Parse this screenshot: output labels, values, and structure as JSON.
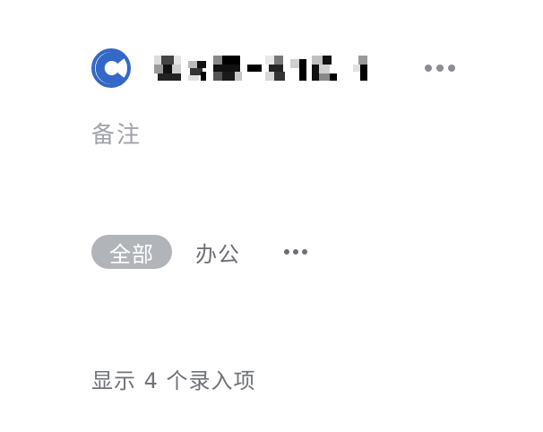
{
  "header": {
    "logo_icon": "circle-c-logo-icon",
    "title_obscured": true,
    "more_icon": "more-horizontal-icon"
  },
  "note": {
    "placeholder": "备注"
  },
  "tags": {
    "items": [
      {
        "label": "全部",
        "active": true
      },
      {
        "label": "办公",
        "active": false
      }
    ],
    "more_icon": "more-horizontal-icon"
  },
  "footer": {
    "count_text": "显示 4 个录入项"
  },
  "colors": {
    "logo_blue": "#3468c6",
    "active_tag_bg": "#b1b4b9",
    "muted_text": "#a1a3a8",
    "secondary_text": "#6c6f75"
  }
}
